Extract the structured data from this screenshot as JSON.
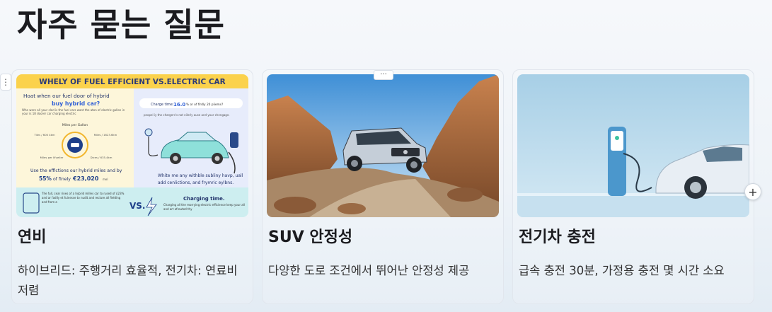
{
  "page": {
    "title": "자주 묻는 질문"
  },
  "cards": [
    {
      "title": "연비",
      "desc": "하이브리드: 주행거리 효율적, 전기차: 연료비 저렴",
      "infographic": {
        "banner": "WHELY OF FUEL EFFICIENT VS.ELECTRIC CAR",
        "left_heading": "Hoat when our fuel door of hybrid",
        "left_heading_accent": "buy hybrid car?",
        "left_intro": "Whe were all your cled is the fuel cars want the aton of electric gallon in your is 18 doorer car charging electric",
        "mpg_label": "Miles per Gallon",
        "mpg_left": "Tiles / 600 4km",
        "mpg_right": "Miles / 1623.6km",
        "mpg_bottom_left": "Miles per Ilfueller",
        "mpg_bottom_right": "Dices / 635.4km",
        "stat_line": "Use the effictions our hybrid miles and by",
        "stat_pct": "55%",
        "stat_mid": "of finely",
        "stat_value": "€23,020",
        "stat_unit": "mel",
        "charge_time_prefix": "Charge time:",
        "charge_time_value": "16.0",
        "charge_time_suffix": "% or of firdly 20 pliems?",
        "right_sub": "peopel iy the chargers's not eilerly ause and your chengage.",
        "right_caption": "White me any withble subliny havp, uall add cenlictions, and frymric eylbns.",
        "bottom_left": "The full, cear rines of a hybrid milles car to rused of £23% and ar fadily et fuinesse to nudit and reclure all fielding and from a",
        "vs": "VS.",
        "bottom_heading": "Charging time.",
        "bottom_right": "Charging all the morrying electric efficience keep your all and art ofrouted thy"
      }
    },
    {
      "title": "SUV 안정성",
      "desc": "다양한 도로 조건에서 뛰어난 안정성 제공"
    },
    {
      "title": "전기차 충전",
      "desc": "급속 충전 30분, 가정용 충전 몇 시간 소요"
    }
  ],
  "controls": {
    "drag_handle": "⋮",
    "more_handle": "···",
    "add_button": "+"
  }
}
